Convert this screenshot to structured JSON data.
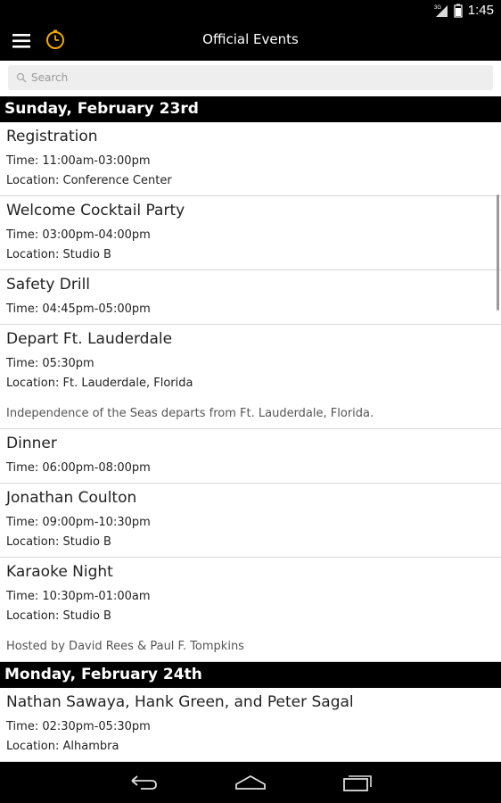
{
  "status_bar": {
    "time": "1:45",
    "network": "3G"
  },
  "header": {
    "title": "Official Events"
  },
  "search": {
    "placeholder": "Search"
  },
  "days": [
    {
      "label": "Sunday, February 23rd",
      "events": [
        {
          "title": "Registration",
          "time": "Time: 11:00am-03:00pm",
          "location": "Location: Conference Center",
          "description": ""
        },
        {
          "title": "Welcome Cocktail Party",
          "time": "Time: 03:00pm-04:00pm",
          "location": "Location: Studio B",
          "description": ""
        },
        {
          "title": "Safety Drill",
          "time": "Time: 04:45pm-05:00pm",
          "location": "",
          "description": ""
        },
        {
          "title": "Depart Ft. Lauderdale",
          "time": "Time: 05:30pm",
          "location": "Location: Ft. Lauderdale, Florida",
          "description": "Independence of the Seas departs from Ft. Lauderdale, Florida."
        },
        {
          "title": "Dinner",
          "time": "Time: 06:00pm-08:00pm",
          "location": "",
          "description": ""
        },
        {
          "title": "Jonathan Coulton",
          "time": "Time: 09:00pm-10:30pm",
          "location": "Location: Studio B",
          "description": ""
        },
        {
          "title": "Karaoke Night",
          "time": "Time: 10:30pm-01:00am",
          "location": "Location: Studio B",
          "description": "Hosted by David Rees & Paul F. Tompkins"
        }
      ]
    },
    {
      "label": "Monday, February 24th",
      "events": [
        {
          "title": "Nathan Sawaya, Hank Green, and Peter Sagal",
          "time": "Time: 02:30pm-05:30pm",
          "location": "Location: Alhambra",
          "description": ""
        }
      ]
    }
  ],
  "colors": {
    "bar_background": "#000000",
    "accent_clock": "#f2a900",
    "divider": "#d8d8d8"
  },
  "icons": {
    "menu": "hamburger-icon",
    "clock": "clock-icon",
    "search": "search-icon",
    "back": "back-icon",
    "home": "home-icon",
    "recents": "recent-apps-icon"
  }
}
